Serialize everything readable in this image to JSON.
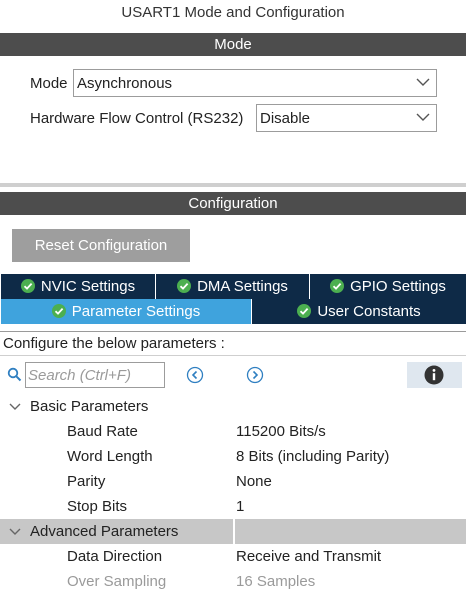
{
  "window_title": "USART1 Mode and Configuration",
  "mode_section": {
    "header": "Mode",
    "mode_label": "Mode",
    "mode_value": "Asynchronous",
    "hw_flow_label": "Hardware Flow Control (RS232)",
    "hw_flow_value": "Disable"
  },
  "config_section": {
    "header": "Configuration",
    "reset_button": "Reset Configuration",
    "tabs_row1": [
      "NVIC Settings",
      "DMA Settings",
      "GPIO Settings"
    ],
    "tabs_row2": [
      "Parameter Settings",
      "User Constants"
    ],
    "active_tab": "Parameter Settings",
    "instructions": "Configure the below parameters :",
    "search_placeholder": "Search (Ctrl+F)"
  },
  "parameters": {
    "basic": {
      "label": "Basic Parameters",
      "items": [
        {
          "name": "Baud Rate",
          "value": "115200 Bits/s"
        },
        {
          "name": "Word Length",
          "value": "8 Bits (including Parity)"
        },
        {
          "name": "Parity",
          "value": "None"
        },
        {
          "name": "Stop Bits",
          "value": "1"
        }
      ]
    },
    "advanced": {
      "label": "Advanced Parameters",
      "items": [
        {
          "name": "Data Direction",
          "value": "Receive and Transmit"
        },
        {
          "name": "Over Sampling",
          "value": "16 Samples"
        }
      ]
    }
  },
  "colors": {
    "section_bar": "#4d4d4d",
    "tab_dark": "#0e2a47",
    "tab_active": "#3fa3dd",
    "check_green": "#4caf50",
    "highlight_row": "#c7c7c7"
  }
}
